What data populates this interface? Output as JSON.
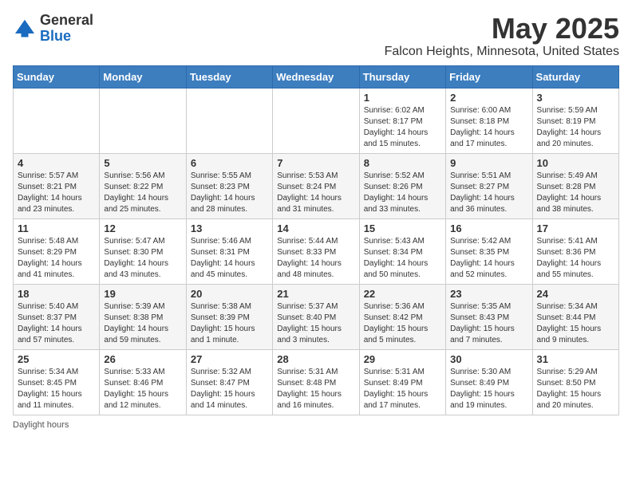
{
  "header": {
    "logo_general": "General",
    "logo_blue": "Blue",
    "month_year": "May 2025",
    "location": "Falcon Heights, Minnesota, United States"
  },
  "weekdays": [
    "Sunday",
    "Monday",
    "Tuesday",
    "Wednesday",
    "Thursday",
    "Friday",
    "Saturday"
  ],
  "weeks": [
    [
      {
        "day": "",
        "info": ""
      },
      {
        "day": "",
        "info": ""
      },
      {
        "day": "",
        "info": ""
      },
      {
        "day": "",
        "info": ""
      },
      {
        "day": "1",
        "info": "Sunrise: 6:02 AM\nSunset: 8:17 PM\nDaylight: 14 hours\nand 15 minutes."
      },
      {
        "day": "2",
        "info": "Sunrise: 6:00 AM\nSunset: 8:18 PM\nDaylight: 14 hours\nand 17 minutes."
      },
      {
        "day": "3",
        "info": "Sunrise: 5:59 AM\nSunset: 8:19 PM\nDaylight: 14 hours\nand 20 minutes."
      }
    ],
    [
      {
        "day": "4",
        "info": "Sunrise: 5:57 AM\nSunset: 8:21 PM\nDaylight: 14 hours\nand 23 minutes."
      },
      {
        "day": "5",
        "info": "Sunrise: 5:56 AM\nSunset: 8:22 PM\nDaylight: 14 hours\nand 25 minutes."
      },
      {
        "day": "6",
        "info": "Sunrise: 5:55 AM\nSunset: 8:23 PM\nDaylight: 14 hours\nand 28 minutes."
      },
      {
        "day": "7",
        "info": "Sunrise: 5:53 AM\nSunset: 8:24 PM\nDaylight: 14 hours\nand 31 minutes."
      },
      {
        "day": "8",
        "info": "Sunrise: 5:52 AM\nSunset: 8:26 PM\nDaylight: 14 hours\nand 33 minutes."
      },
      {
        "day": "9",
        "info": "Sunrise: 5:51 AM\nSunset: 8:27 PM\nDaylight: 14 hours\nand 36 minutes."
      },
      {
        "day": "10",
        "info": "Sunrise: 5:49 AM\nSunset: 8:28 PM\nDaylight: 14 hours\nand 38 minutes."
      }
    ],
    [
      {
        "day": "11",
        "info": "Sunrise: 5:48 AM\nSunset: 8:29 PM\nDaylight: 14 hours\nand 41 minutes."
      },
      {
        "day": "12",
        "info": "Sunrise: 5:47 AM\nSunset: 8:30 PM\nDaylight: 14 hours\nand 43 minutes."
      },
      {
        "day": "13",
        "info": "Sunrise: 5:46 AM\nSunset: 8:31 PM\nDaylight: 14 hours\nand 45 minutes."
      },
      {
        "day": "14",
        "info": "Sunrise: 5:44 AM\nSunset: 8:33 PM\nDaylight: 14 hours\nand 48 minutes."
      },
      {
        "day": "15",
        "info": "Sunrise: 5:43 AM\nSunset: 8:34 PM\nDaylight: 14 hours\nand 50 minutes."
      },
      {
        "day": "16",
        "info": "Sunrise: 5:42 AM\nSunset: 8:35 PM\nDaylight: 14 hours\nand 52 minutes."
      },
      {
        "day": "17",
        "info": "Sunrise: 5:41 AM\nSunset: 8:36 PM\nDaylight: 14 hours\nand 55 minutes."
      }
    ],
    [
      {
        "day": "18",
        "info": "Sunrise: 5:40 AM\nSunset: 8:37 PM\nDaylight: 14 hours\nand 57 minutes."
      },
      {
        "day": "19",
        "info": "Sunrise: 5:39 AM\nSunset: 8:38 PM\nDaylight: 14 hours\nand 59 minutes."
      },
      {
        "day": "20",
        "info": "Sunrise: 5:38 AM\nSunset: 8:39 PM\nDaylight: 15 hours\nand 1 minute."
      },
      {
        "day": "21",
        "info": "Sunrise: 5:37 AM\nSunset: 8:40 PM\nDaylight: 15 hours\nand 3 minutes."
      },
      {
        "day": "22",
        "info": "Sunrise: 5:36 AM\nSunset: 8:42 PM\nDaylight: 15 hours\nand 5 minutes."
      },
      {
        "day": "23",
        "info": "Sunrise: 5:35 AM\nSunset: 8:43 PM\nDaylight: 15 hours\nand 7 minutes."
      },
      {
        "day": "24",
        "info": "Sunrise: 5:34 AM\nSunset: 8:44 PM\nDaylight: 15 hours\nand 9 minutes."
      }
    ],
    [
      {
        "day": "25",
        "info": "Sunrise: 5:34 AM\nSunset: 8:45 PM\nDaylight: 15 hours\nand 11 minutes."
      },
      {
        "day": "26",
        "info": "Sunrise: 5:33 AM\nSunset: 8:46 PM\nDaylight: 15 hours\nand 12 minutes."
      },
      {
        "day": "27",
        "info": "Sunrise: 5:32 AM\nSunset: 8:47 PM\nDaylight: 15 hours\nand 14 minutes."
      },
      {
        "day": "28",
        "info": "Sunrise: 5:31 AM\nSunset: 8:48 PM\nDaylight: 15 hours\nand 16 minutes."
      },
      {
        "day": "29",
        "info": "Sunrise: 5:31 AM\nSunset: 8:49 PM\nDaylight: 15 hours\nand 17 minutes."
      },
      {
        "day": "30",
        "info": "Sunrise: 5:30 AM\nSunset: 8:49 PM\nDaylight: 15 hours\nand 19 minutes."
      },
      {
        "day": "31",
        "info": "Sunrise: 5:29 AM\nSunset: 8:50 PM\nDaylight: 15 hours\nand 20 minutes."
      }
    ]
  ],
  "footer": {
    "note": "Daylight hours"
  }
}
